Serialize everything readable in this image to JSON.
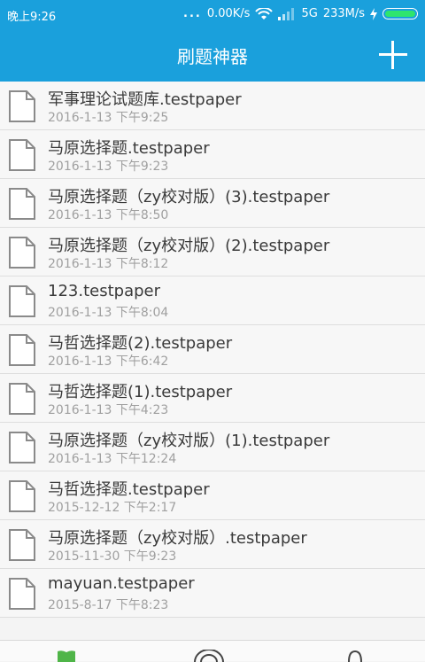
{
  "status_bar": {
    "time": "晚上9:26",
    "dots": "...",
    "network_speed": "0.00K/s",
    "network_type": "5G",
    "net_speed2": "233M/s"
  },
  "app": {
    "title": "刷题神器",
    "add_icon": "plus-icon"
  },
  "files": [
    {
      "name": "军事理论试题库.testpaper",
      "date": "2016-1-13 下午9:25"
    },
    {
      "name": "马原选择题.testpaper",
      "date": "2016-1-13 下午9:23"
    },
    {
      "name": "马原选择题（zy校对版）(3).testpaper",
      "date": "2016-1-13 下午8:50"
    },
    {
      "name": "马原选择题（zy校对版）(2).testpaper",
      "date": "2016-1-13 下午8:12"
    },
    {
      "name": "123.testpaper",
      "date": "2016-1-13 下午8:04"
    },
    {
      "name": "马哲选择题(2).testpaper",
      "date": "2016-1-13 下午6:42"
    },
    {
      "name": "马哲选择题(1).testpaper",
      "date": "2016-1-13 下午4:23"
    },
    {
      "name": "马原选择题（zy校对版）(1).testpaper",
      "date": "2016-1-13 下午12:24"
    },
    {
      "name": "马哲选择题.testpaper",
      "date": "2015-12-12 下午2:17"
    },
    {
      "name": "马原选择题（zy校对版）.testpaper",
      "date": "2015-11-30 下午9:23"
    },
    {
      "name": "mayuan.testpaper",
      "date": "2015-8-17 下午8:23"
    }
  ],
  "bottom_nav": [
    "book-icon",
    "target-icon",
    "user-icon"
  ],
  "colors": {
    "primary": "#1aa0dc",
    "battery": "#2ee56d",
    "nav_active": "#4fb548"
  }
}
